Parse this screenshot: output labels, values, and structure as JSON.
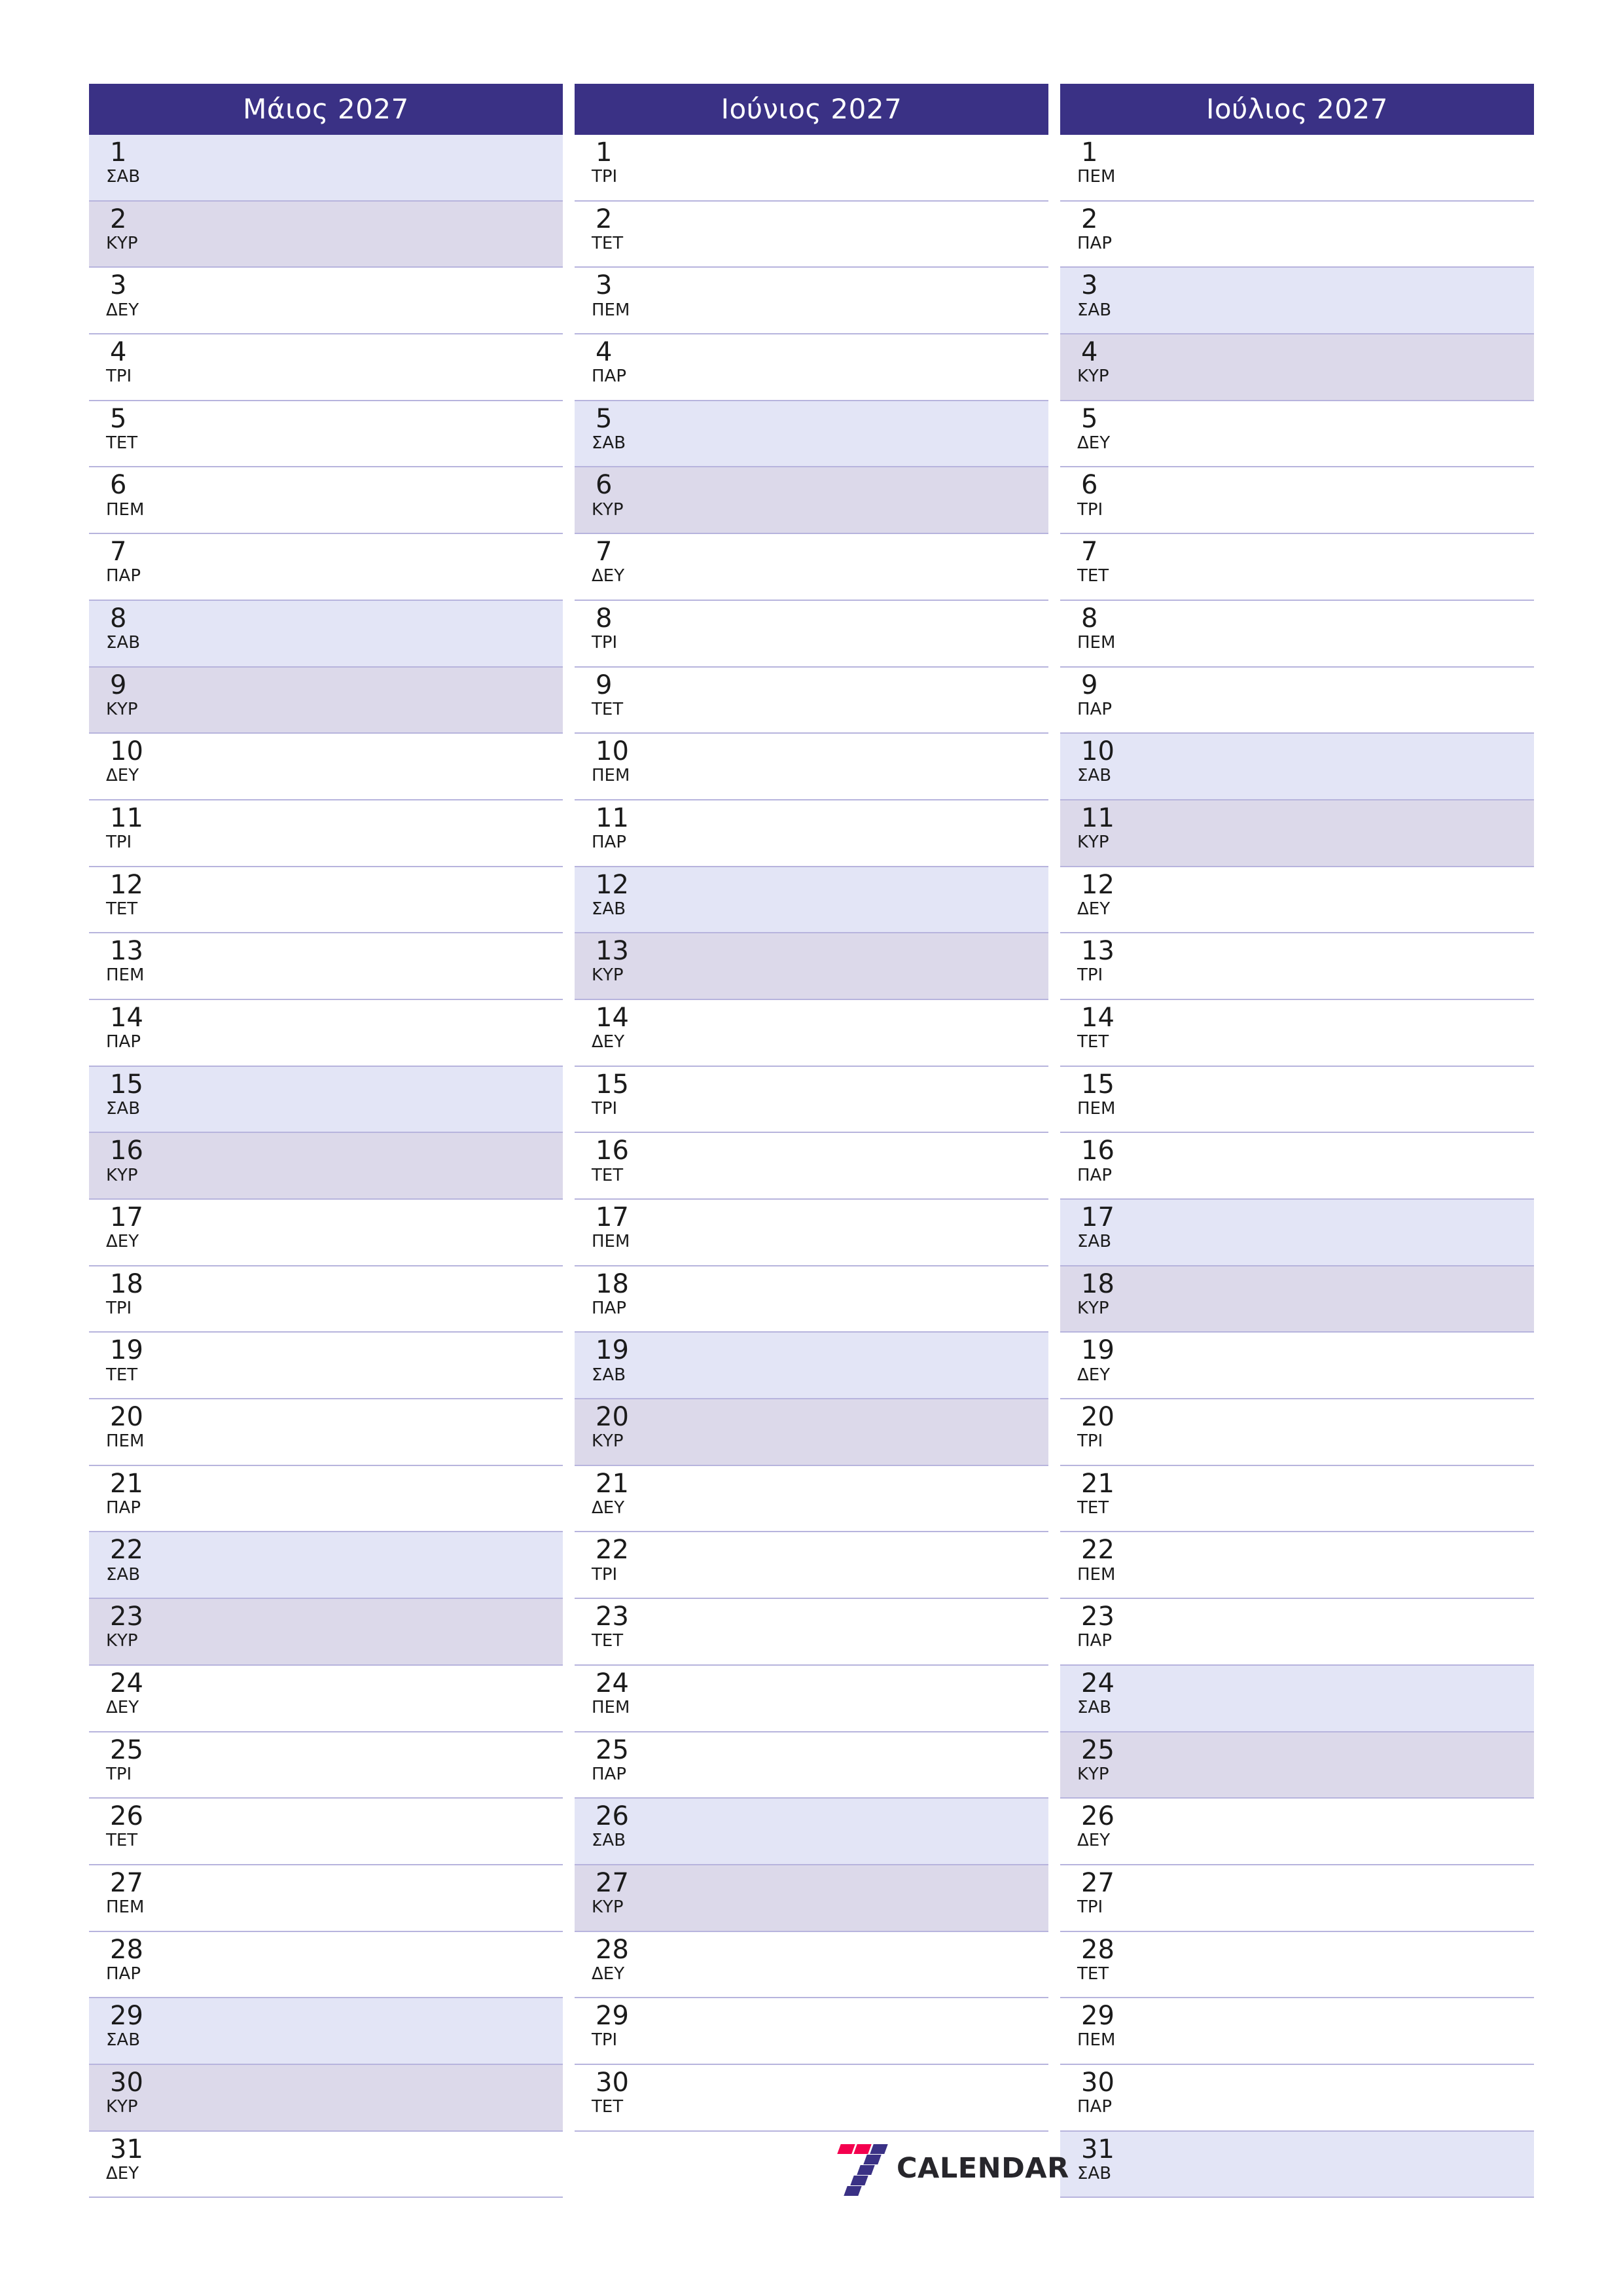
{
  "months": [
    {
      "title": "Μάιος 2027",
      "days": [
        {
          "num": "1",
          "wd": "ΣΑΒ",
          "type": "sat"
        },
        {
          "num": "2",
          "wd": "ΚΥΡ",
          "type": "sun"
        },
        {
          "num": "3",
          "wd": "ΔΕΥ",
          "type": "wd"
        },
        {
          "num": "4",
          "wd": "ΤΡΙ",
          "type": "wd"
        },
        {
          "num": "5",
          "wd": "ΤΕΤ",
          "type": "wd"
        },
        {
          "num": "6",
          "wd": "ΠΕΜ",
          "type": "wd"
        },
        {
          "num": "7",
          "wd": "ΠΑΡ",
          "type": "wd"
        },
        {
          "num": "8",
          "wd": "ΣΑΒ",
          "type": "sat"
        },
        {
          "num": "9",
          "wd": "ΚΥΡ",
          "type": "sun"
        },
        {
          "num": "10",
          "wd": "ΔΕΥ",
          "type": "wd"
        },
        {
          "num": "11",
          "wd": "ΤΡΙ",
          "type": "wd"
        },
        {
          "num": "12",
          "wd": "ΤΕΤ",
          "type": "wd"
        },
        {
          "num": "13",
          "wd": "ΠΕΜ",
          "type": "wd"
        },
        {
          "num": "14",
          "wd": "ΠΑΡ",
          "type": "wd"
        },
        {
          "num": "15",
          "wd": "ΣΑΒ",
          "type": "sat"
        },
        {
          "num": "16",
          "wd": "ΚΥΡ",
          "type": "sun"
        },
        {
          "num": "17",
          "wd": "ΔΕΥ",
          "type": "wd"
        },
        {
          "num": "18",
          "wd": "ΤΡΙ",
          "type": "wd"
        },
        {
          "num": "19",
          "wd": "ΤΕΤ",
          "type": "wd"
        },
        {
          "num": "20",
          "wd": "ΠΕΜ",
          "type": "wd"
        },
        {
          "num": "21",
          "wd": "ΠΑΡ",
          "type": "wd"
        },
        {
          "num": "22",
          "wd": "ΣΑΒ",
          "type": "sat"
        },
        {
          "num": "23",
          "wd": "ΚΥΡ",
          "type": "sun"
        },
        {
          "num": "24",
          "wd": "ΔΕΥ",
          "type": "wd"
        },
        {
          "num": "25",
          "wd": "ΤΡΙ",
          "type": "wd"
        },
        {
          "num": "26",
          "wd": "ΤΕΤ",
          "type": "wd"
        },
        {
          "num": "27",
          "wd": "ΠΕΜ",
          "type": "wd"
        },
        {
          "num": "28",
          "wd": "ΠΑΡ",
          "type": "wd"
        },
        {
          "num": "29",
          "wd": "ΣΑΒ",
          "type": "sat"
        },
        {
          "num": "30",
          "wd": "ΚΥΡ",
          "type": "sun"
        },
        {
          "num": "31",
          "wd": "ΔΕΥ",
          "type": "wd"
        }
      ]
    },
    {
      "title": "Ιούνιος 2027",
      "days": [
        {
          "num": "1",
          "wd": "ΤΡΙ",
          "type": "wd"
        },
        {
          "num": "2",
          "wd": "ΤΕΤ",
          "type": "wd"
        },
        {
          "num": "3",
          "wd": "ΠΕΜ",
          "type": "wd"
        },
        {
          "num": "4",
          "wd": "ΠΑΡ",
          "type": "wd"
        },
        {
          "num": "5",
          "wd": "ΣΑΒ",
          "type": "sat"
        },
        {
          "num": "6",
          "wd": "ΚΥΡ",
          "type": "sun"
        },
        {
          "num": "7",
          "wd": "ΔΕΥ",
          "type": "wd"
        },
        {
          "num": "8",
          "wd": "ΤΡΙ",
          "type": "wd"
        },
        {
          "num": "9",
          "wd": "ΤΕΤ",
          "type": "wd"
        },
        {
          "num": "10",
          "wd": "ΠΕΜ",
          "type": "wd"
        },
        {
          "num": "11",
          "wd": "ΠΑΡ",
          "type": "wd"
        },
        {
          "num": "12",
          "wd": "ΣΑΒ",
          "type": "sat"
        },
        {
          "num": "13",
          "wd": "ΚΥΡ",
          "type": "sun"
        },
        {
          "num": "14",
          "wd": "ΔΕΥ",
          "type": "wd"
        },
        {
          "num": "15",
          "wd": "ΤΡΙ",
          "type": "wd"
        },
        {
          "num": "16",
          "wd": "ΤΕΤ",
          "type": "wd"
        },
        {
          "num": "17",
          "wd": "ΠΕΜ",
          "type": "wd"
        },
        {
          "num": "18",
          "wd": "ΠΑΡ",
          "type": "wd"
        },
        {
          "num": "19",
          "wd": "ΣΑΒ",
          "type": "sat"
        },
        {
          "num": "20",
          "wd": "ΚΥΡ",
          "type": "sun"
        },
        {
          "num": "21",
          "wd": "ΔΕΥ",
          "type": "wd"
        },
        {
          "num": "22",
          "wd": "ΤΡΙ",
          "type": "wd"
        },
        {
          "num": "23",
          "wd": "ΤΕΤ",
          "type": "wd"
        },
        {
          "num": "24",
          "wd": "ΠΕΜ",
          "type": "wd"
        },
        {
          "num": "25",
          "wd": "ΠΑΡ",
          "type": "wd"
        },
        {
          "num": "26",
          "wd": "ΣΑΒ",
          "type": "sat"
        },
        {
          "num": "27",
          "wd": "ΚΥΡ",
          "type": "sun"
        },
        {
          "num": "28",
          "wd": "ΔΕΥ",
          "type": "wd"
        },
        {
          "num": "29",
          "wd": "ΤΡΙ",
          "type": "wd"
        },
        {
          "num": "30",
          "wd": "ΤΕΤ",
          "type": "wd"
        }
      ]
    },
    {
      "title": "Ιούλιος 2027",
      "days": [
        {
          "num": "1",
          "wd": "ΠΕΜ",
          "type": "wd"
        },
        {
          "num": "2",
          "wd": "ΠΑΡ",
          "type": "wd"
        },
        {
          "num": "3",
          "wd": "ΣΑΒ",
          "type": "sat"
        },
        {
          "num": "4",
          "wd": "ΚΥΡ",
          "type": "sun"
        },
        {
          "num": "5",
          "wd": "ΔΕΥ",
          "type": "wd"
        },
        {
          "num": "6",
          "wd": "ΤΡΙ",
          "type": "wd"
        },
        {
          "num": "7",
          "wd": "ΤΕΤ",
          "type": "wd"
        },
        {
          "num": "8",
          "wd": "ΠΕΜ",
          "type": "wd"
        },
        {
          "num": "9",
          "wd": "ΠΑΡ",
          "type": "wd"
        },
        {
          "num": "10",
          "wd": "ΣΑΒ",
          "type": "sat"
        },
        {
          "num": "11",
          "wd": "ΚΥΡ",
          "type": "sun"
        },
        {
          "num": "12",
          "wd": "ΔΕΥ",
          "type": "wd"
        },
        {
          "num": "13",
          "wd": "ΤΡΙ",
          "type": "wd"
        },
        {
          "num": "14",
          "wd": "ΤΕΤ",
          "type": "wd"
        },
        {
          "num": "15",
          "wd": "ΠΕΜ",
          "type": "wd"
        },
        {
          "num": "16",
          "wd": "ΠΑΡ",
          "type": "wd"
        },
        {
          "num": "17",
          "wd": "ΣΑΒ",
          "type": "sat"
        },
        {
          "num": "18",
          "wd": "ΚΥΡ",
          "type": "sun"
        },
        {
          "num": "19",
          "wd": "ΔΕΥ",
          "type": "wd"
        },
        {
          "num": "20",
          "wd": "ΤΡΙ",
          "type": "wd"
        },
        {
          "num": "21",
          "wd": "ΤΕΤ",
          "type": "wd"
        },
        {
          "num": "22",
          "wd": "ΠΕΜ",
          "type": "wd"
        },
        {
          "num": "23",
          "wd": "ΠΑΡ",
          "type": "wd"
        },
        {
          "num": "24",
          "wd": "ΣΑΒ",
          "type": "sat"
        },
        {
          "num": "25",
          "wd": "ΚΥΡ",
          "type": "sun"
        },
        {
          "num": "26",
          "wd": "ΔΕΥ",
          "type": "wd"
        },
        {
          "num": "27",
          "wd": "ΤΡΙ",
          "type": "wd"
        },
        {
          "num": "28",
          "wd": "ΤΕΤ",
          "type": "wd"
        },
        {
          "num": "29",
          "wd": "ΠΕΜ",
          "type": "wd"
        },
        {
          "num": "30",
          "wd": "ΠΑΡ",
          "type": "wd"
        },
        {
          "num": "31",
          "wd": "ΣΑΒ",
          "type": "sat"
        }
      ]
    }
  ],
  "logo": {
    "text": "CALENDAR",
    "mark_name": "seven-logo-icon"
  },
  "colors": {
    "header_bg": "#3a3185",
    "saturday_bg": "#e3e5f6",
    "sunday_bg": "#dcd9ea",
    "row_border": "#b7b4dd",
    "logo_red": "#f4004e",
    "logo_blue": "#3a3185",
    "logo_text": "#27262b"
  }
}
